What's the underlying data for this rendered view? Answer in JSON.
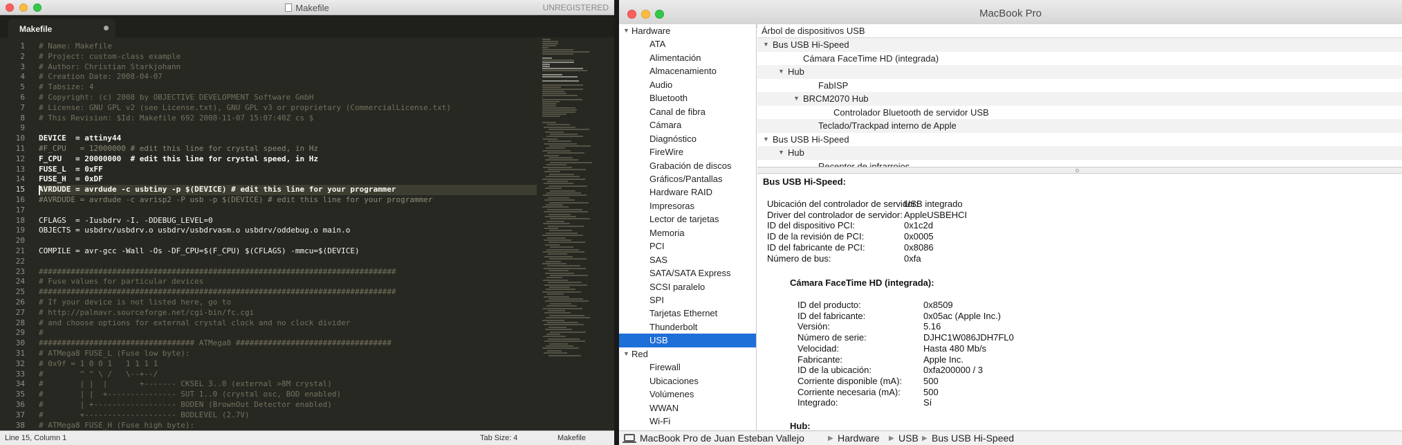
{
  "sublime": {
    "title": "Makefile",
    "unregistered": "UNREGISTERED",
    "tab_label": "Makefile",
    "current_line": 15,
    "lines": [
      {
        "n": "1",
        "t": "# Name: Makefile",
        "s": "comment"
      },
      {
        "n": "2",
        "t": "# Project: custom-class example",
        "s": "comment"
      },
      {
        "n": "3",
        "t": "# Author: Christian Starkjohann",
        "s": "comment"
      },
      {
        "n": "4",
        "t": "# Creation Date: 2008-04-07",
        "s": "comment"
      },
      {
        "n": "5",
        "t": "# Tabsize: 4",
        "s": "comment"
      },
      {
        "n": "6",
        "t": "# Copyright: (c) 2008 by OBJECTIVE DEVELOPMENT Software GmbH",
        "s": "comment"
      },
      {
        "n": "7",
        "t": "# License: GNU GPL v2 (see License.txt), GNU GPL v3 or proprietary (CommercialLicense.txt)",
        "s": "comment"
      },
      {
        "n": "8",
        "t": "# This Revision: $Id: Makefile 692 2008-11-07 15:07:40Z cs $",
        "s": "comment"
      },
      {
        "n": "9",
        "t": "",
        "s": "plain"
      },
      {
        "n": "10",
        "t": "DEVICE  = attiny44",
        "s": "bold"
      },
      {
        "n": "11",
        "t": "#F_CPU   = 12000000 # edit this line for crystal speed, in Hz",
        "s": "dim"
      },
      {
        "n": "12",
        "t": "F_CPU   = 20000000  # edit this line for crystal speed, in Hz",
        "s": "bold"
      },
      {
        "n": "13",
        "t": "FUSE_L  = 0xFF",
        "s": "bold"
      },
      {
        "n": "14",
        "t": "FUSE_H  = 0xDF",
        "s": "bold"
      },
      {
        "n": "15",
        "t": "AVRDUDE = avrdude -c usbtiny -p $(DEVICE) # edit this line for your programmer",
        "s": "bold"
      },
      {
        "n": "16",
        "t": "#AVRDUDE = avrdude -c avrisp2 -P usb -p $(DEVICE) # edit this line for your programmer",
        "s": "dim"
      },
      {
        "n": "17",
        "t": "",
        "s": "plain"
      },
      {
        "n": "18",
        "t": "CFLAGS  = -Iusbdrv -I. -DDEBUG_LEVEL=0",
        "s": "plain"
      },
      {
        "n": "19",
        "t": "OBJECTS = usbdrv/usbdrv.o usbdrv/usbdrvasm.o usbdrv/oddebug.o main.o",
        "s": "plain"
      },
      {
        "n": "20",
        "t": "",
        "s": "plain"
      },
      {
        "n": "21",
        "t": "COMPILE = avr-gcc -Wall -Os -DF_CPU=$(F_CPU) $(CFLAGS) -mmcu=$(DEVICE)",
        "s": "plain"
      },
      {
        "n": "22",
        "t": "",
        "s": "plain"
      },
      {
        "n": "23",
        "t": "##############################################################################",
        "s": "comment"
      },
      {
        "n": "24",
        "t": "# Fuse values for particular devices",
        "s": "comment"
      },
      {
        "n": "25",
        "t": "##############################################################################",
        "s": "comment"
      },
      {
        "n": "26",
        "t": "# If your device is not listed here, go to",
        "s": "comment"
      },
      {
        "n": "27",
        "t": "# http://palmavr.sourceforge.net/cgi-bin/fc.cgi",
        "s": "comment"
      },
      {
        "n": "28",
        "t": "# and choose options for external crystal clock and no clock divider",
        "s": "comment"
      },
      {
        "n": "29",
        "t": "#",
        "s": "comment"
      },
      {
        "n": "30",
        "t": "################################## ATMega8 ##################################",
        "s": "comment"
      },
      {
        "n": "31",
        "t": "# ATMega8 FUSE_L (Fuse low byte):",
        "s": "comment"
      },
      {
        "n": "32",
        "t": "# 0x9f = 1 0 0 1   1 1 1 1",
        "s": "comment"
      },
      {
        "n": "33",
        "t": "#        ^ ^ \\ /   \\--+--/",
        "s": "comment"
      },
      {
        "n": "34",
        "t": "#        | |  |       +------- CKSEL 3..0 (external >8M crystal)",
        "s": "comment"
      },
      {
        "n": "35",
        "t": "#        | |  +--------------- SUT 1..0 (crystal osc, BOD enabled)",
        "s": "comment"
      },
      {
        "n": "36",
        "t": "#        | +------------------ BODEN (BrownOut Detector enabled)",
        "s": "comment"
      },
      {
        "n": "37",
        "t": "#        +-------------------- BODLEVEL (2.7V)",
        "s": "comment"
      },
      {
        "n": "38",
        "t": "# ATMega8 FUSE_H (Fuse high byte):",
        "s": "comment"
      }
    ],
    "status_position": "Line 15, Column 1",
    "status_tab_size": "Tab Size: 4",
    "status_syntax": "Makefile"
  },
  "sysinfo": {
    "title": "MacBook Pro",
    "sidebar": [
      {
        "label": "Hardware",
        "level": 0,
        "tri": "▼"
      },
      {
        "label": "ATA",
        "level": 1
      },
      {
        "label": "Alimentación",
        "level": 1
      },
      {
        "label": "Almacenamiento",
        "level": 1
      },
      {
        "label": "Audio",
        "level": 1
      },
      {
        "label": "Bluetooth",
        "level": 1
      },
      {
        "label": "Canal de fibra",
        "level": 1
      },
      {
        "label": "Cámara",
        "level": 1
      },
      {
        "label": "Diagnóstico",
        "level": 1
      },
      {
        "label": "FireWire",
        "level": 1
      },
      {
        "label": "Grabación de discos",
        "level": 1
      },
      {
        "label": "Gráficos/Pantallas",
        "level": 1
      },
      {
        "label": "Hardware RAID",
        "level": 1
      },
      {
        "label": "Impresoras",
        "level": 1
      },
      {
        "label": "Lector de tarjetas",
        "level": 1
      },
      {
        "label": "Memoria",
        "level": 1
      },
      {
        "label": "PCI",
        "level": 1
      },
      {
        "label": "SAS",
        "level": 1
      },
      {
        "label": "SATA/SATA Express",
        "level": 1
      },
      {
        "label": "SCSI paralelo",
        "level": 1
      },
      {
        "label": "SPI",
        "level": 1
      },
      {
        "label": "Tarjetas Ethernet",
        "level": 1
      },
      {
        "label": "Thunderbolt",
        "level": 1
      },
      {
        "label": "USB",
        "level": 1,
        "selected": true
      },
      {
        "label": "Red",
        "level": 0,
        "tri": "▼"
      },
      {
        "label": "Firewall",
        "level": 1
      },
      {
        "label": "Ubicaciones",
        "level": 1
      },
      {
        "label": "Volúmenes",
        "level": 1
      },
      {
        "label": "WWAN",
        "level": 1
      },
      {
        "label": "Wi-Fi",
        "level": 1
      }
    ],
    "tree_header": "Árbol de dispositivos USB",
    "tree": [
      {
        "label": "Bus USB Hi-Speed",
        "level": 0,
        "tri": "▼"
      },
      {
        "label": "Cámara FaceTime HD (integrada)",
        "level": 2
      },
      {
        "label": "Hub",
        "level": 1,
        "tri": "▼"
      },
      {
        "label": "FabISP",
        "level": 3
      },
      {
        "label": "BRCM2070 Hub",
        "level": 2,
        "tri": "▼"
      },
      {
        "label": "Controlador Bluetooth de servidor USB",
        "level": 4
      },
      {
        "label": "Teclado/Trackpad interno de Apple",
        "level": 3
      },
      {
        "label": "Bus USB Hi-Speed",
        "level": 0,
        "tri": "▼"
      },
      {
        "label": "Hub",
        "level": 1,
        "tri": "▼"
      },
      {
        "label": "Receptor de infrarrojos",
        "level": 3
      }
    ],
    "detail": {
      "heading": "Bus USB Hi-Speed:",
      "bus_props": [
        {
          "k": "Ubicación del controlador de servidor:",
          "v": "USB integrado"
        },
        {
          "k": "Driver del controlador de servidor:",
          "v": "AppleUSBEHCI"
        },
        {
          "k": "ID del dispositivo PCI:",
          "v": "0x1c2d"
        },
        {
          "k": "ID de la revisión de PCI:",
          "v": "0x0005"
        },
        {
          "k": "ID del fabricante de PCI:",
          "v": "0x8086"
        },
        {
          "k": "Número de bus:",
          "v": "0xfa"
        }
      ],
      "sub_heading": "Cámara FaceTime HD (integrada):",
      "cam_props": [
        {
          "k": "ID del producto:",
          "v": "0x8509"
        },
        {
          "k": "ID del fabricante:",
          "v": "0x05ac  (Apple Inc.)"
        },
        {
          "k": "Versión:",
          "v": "5.16"
        },
        {
          "k": "Número de serie:",
          "v": "DJHC1W086JDH7FL0"
        },
        {
          "k": "Velocidad:",
          "v": "Hasta 480 Mb/s"
        },
        {
          "k": "Fabricante:",
          "v": "Apple Inc."
        },
        {
          "k": "ID de la ubicación:",
          "v": "0xfa200000 / 3"
        },
        {
          "k": "Corriente disponible (mA):",
          "v": "500"
        },
        {
          "k": "Corriente necesaria (mA):",
          "v": "500"
        },
        {
          "k": "Integrado:",
          "v": "Sí"
        }
      ],
      "next_heading": "Hub:"
    },
    "pathbar": [
      "MacBook Pro de Juan Esteban Vallejo",
      "Hardware",
      "USB",
      "Bus USB Hi-Speed"
    ]
  }
}
